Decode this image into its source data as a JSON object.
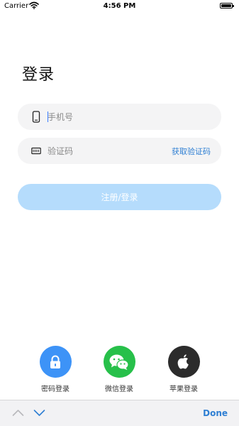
{
  "status_bar": {
    "carrier": "Carrier",
    "time": "4:56 PM",
    "wifi_icon": "wifi-icon",
    "battery_icon": "battery-icon"
  },
  "login": {
    "title": "登录",
    "phone_field": {
      "placeholder": "手机号",
      "value": "",
      "icon": "phone-icon"
    },
    "code_field": {
      "placeholder": "验证码",
      "value": "",
      "icon": "keyboard-icon",
      "get_code_label": "获取验证码"
    },
    "submit_label": "注册/登录"
  },
  "alt_logins": [
    {
      "label": "密码登录",
      "icon": "lock-icon",
      "color": "#3d93f7"
    },
    {
      "label": "微信登录",
      "icon": "wechat-icon",
      "color": "#27c04a"
    },
    {
      "label": "苹果登录",
      "icon": "apple-icon",
      "color": "#2c2c2c"
    }
  ],
  "keyboard_toolbar": {
    "up_icon": "chevron-up-icon",
    "down_icon": "chevron-down-icon",
    "done_label": "Done"
  },
  "colors": {
    "accent": "#2f7fd3",
    "submit_disabled": "#b5dcfc",
    "field_background": "#f4f4f5"
  }
}
